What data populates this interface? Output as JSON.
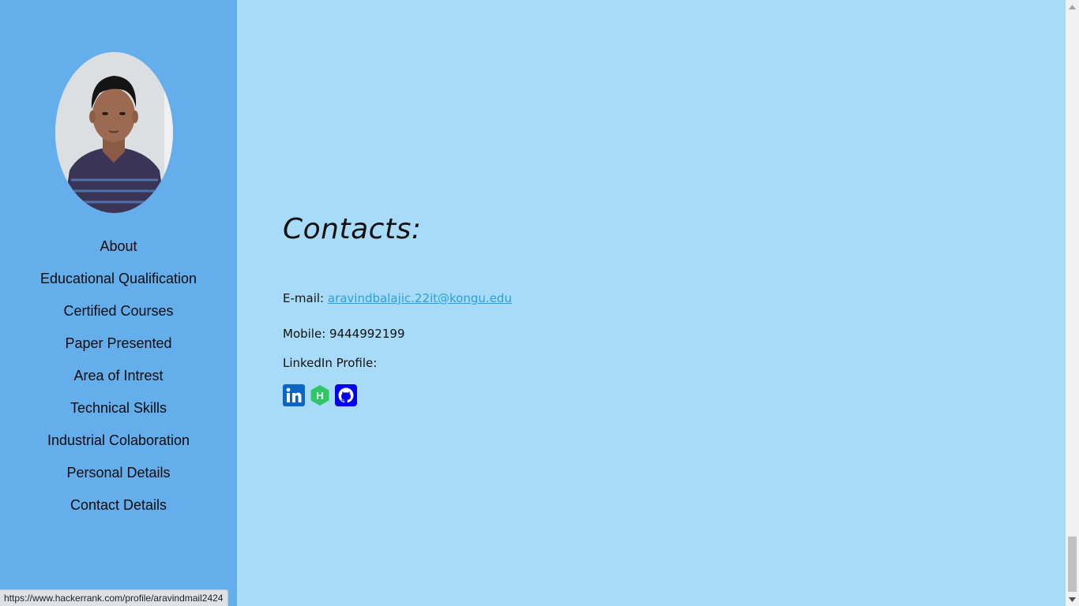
{
  "sidebar": {
    "nav_items": [
      {
        "label": "About"
      },
      {
        "label": "Educational Qualification"
      },
      {
        "label": "Certified Courses"
      },
      {
        "label": "Paper Presented"
      },
      {
        "label": "Area of Intrest"
      },
      {
        "label": "Technical Skills"
      },
      {
        "label": "Industrial Colaboration"
      },
      {
        "label": "Personal Details"
      },
      {
        "label": "Contact Details"
      }
    ]
  },
  "contacts": {
    "title": "Contacts:",
    "email_label": "E-mail:",
    "email_value": "aravindbalajic.22it@kongu.edu",
    "mobile_label": "Mobile:",
    "mobile_value": "9444992199",
    "linkedin_label": "LinkedIn Profile:",
    "icons": [
      "linkedin-icon",
      "hackerrank-icon",
      "github-icon"
    ]
  },
  "status_bar": {
    "url": "https://www.hackerrank.com/profile/aravindmail2424"
  },
  "colors": {
    "sidebar_bg": "#64aeec",
    "main_bg": "#a8dbf7",
    "link": "#2aa0dc",
    "linkedin": "#0a66c2",
    "hackerrank": "#2ec866",
    "github": "#0000ee"
  }
}
